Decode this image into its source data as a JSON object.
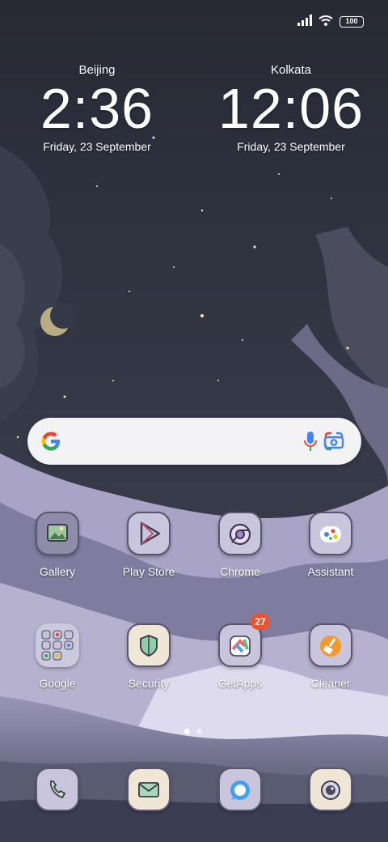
{
  "status_bar": {
    "battery_level": "100",
    "icons": [
      "signal-icon",
      "wifi-icon",
      "battery-icon"
    ]
  },
  "clocks": [
    {
      "city": "Beijing",
      "time": "2:36",
      "date": "Friday, 23 September"
    },
    {
      "city": "Kolkata",
      "time": "12:06",
      "date": "Friday, 23 September"
    }
  ],
  "search_bar": {
    "icons": [
      "google-logo-icon",
      "microphone-icon",
      "google-lens-icon"
    ]
  },
  "apps_row1": [
    {
      "label": "Gallery",
      "icon": "gallery-icon"
    },
    {
      "label": "Play Store",
      "icon": "play-store-icon"
    },
    {
      "label": "Chrome",
      "icon": "chrome-icon"
    },
    {
      "label": "Assistant",
      "icon": "assistant-icon"
    }
  ],
  "apps_row2": [
    {
      "label": "Google",
      "icon": "google-folder-icon"
    },
    {
      "label": "Security",
      "icon": "security-shield-icon"
    },
    {
      "label": "GetApps",
      "icon": "getapps-icon",
      "badge": "27"
    },
    {
      "label": "Cleaner",
      "icon": "cleaner-broom-icon"
    }
  ],
  "dock": [
    {
      "icon": "phone-icon"
    },
    {
      "icon": "messages-icon"
    },
    {
      "icon": "browser-icon"
    },
    {
      "icon": "camera-icon"
    }
  ],
  "page_indicator": {
    "pages": 2,
    "current": 1
  },
  "colors": {
    "sky": "#2f3340",
    "clouds": "#b9b4d2",
    "badge": "#f0522e",
    "search_bg": "#f3f3f5"
  }
}
